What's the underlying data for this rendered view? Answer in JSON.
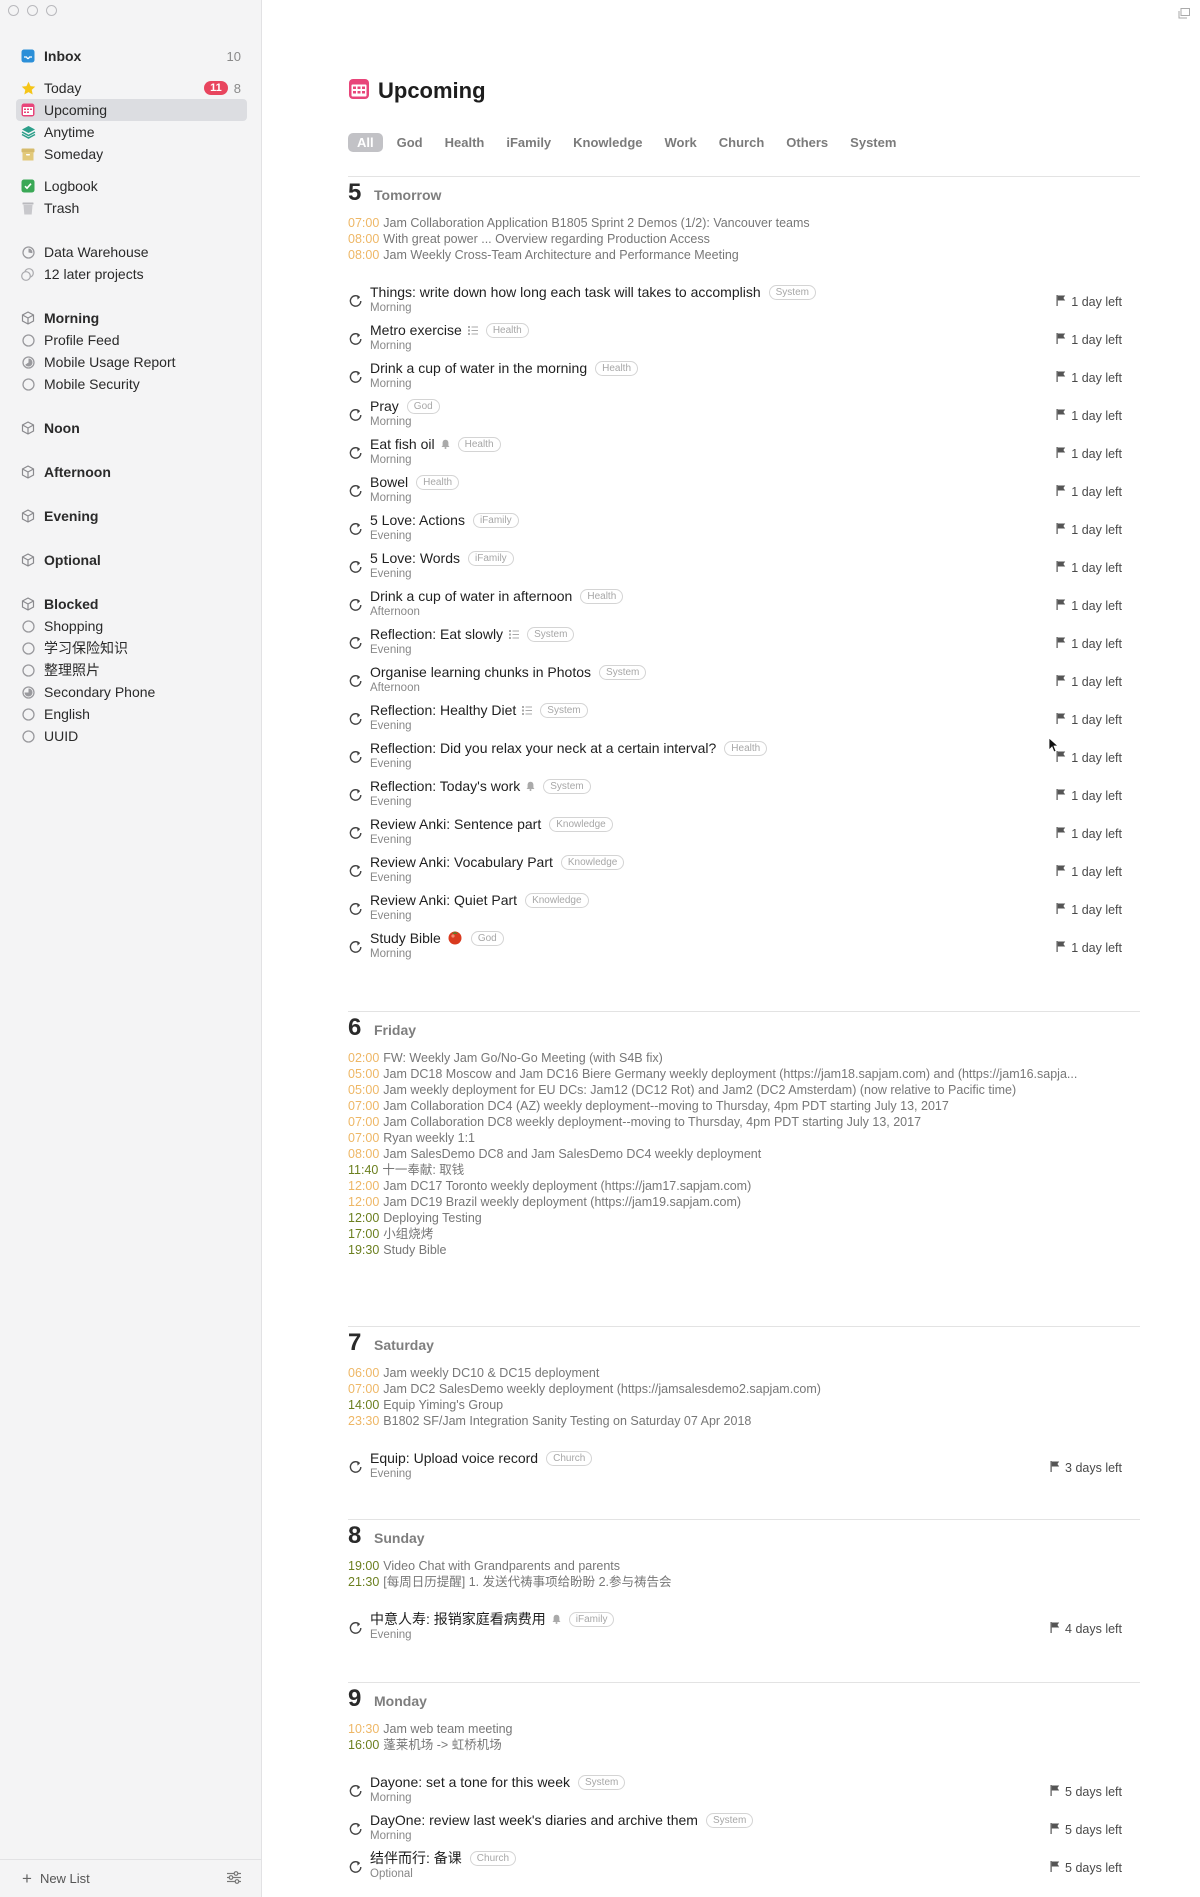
{
  "sidebar": {
    "inbox": {
      "label": "Inbox",
      "count": "10"
    },
    "today": {
      "label": "Today",
      "badge": "11",
      "count": "8"
    },
    "upcoming": {
      "label": "Upcoming"
    },
    "anytime": {
      "label": "Anytime"
    },
    "someday": {
      "label": "Someday"
    },
    "logbook": {
      "label": "Logbook"
    },
    "trash": {
      "label": "Trash"
    },
    "data_warehouse": {
      "label": "Data Warehouse"
    },
    "later_projects": {
      "label": "12 later projects"
    },
    "morning": {
      "label": "Morning",
      "items": [
        "Profile Feed",
        "Mobile Usage Report",
        "Mobile Security"
      ]
    },
    "noon": {
      "label": "Noon"
    },
    "afternoon": {
      "label": "Afternoon"
    },
    "evening": {
      "label": "Evening"
    },
    "optional": {
      "label": "Optional"
    },
    "blocked": {
      "label": "Blocked",
      "items": [
        "Shopping",
        "学习保险知识",
        "整理照片",
        "Secondary Phone",
        "English",
        "UUID"
      ]
    },
    "new_list": "New List"
  },
  "header": {
    "title": "Upcoming"
  },
  "filters": [
    "All",
    "God",
    "Health",
    "iFamily",
    "Knowledge",
    "Work",
    "Church",
    "Others",
    "System"
  ],
  "days": [
    {
      "num": "5",
      "name": "Tomorrow",
      "events": [
        {
          "time": "07:00",
          "text": "Jam Collaboration Application B1805 Sprint 2 Demos (1/2): Vancouver teams",
          "green": false
        },
        {
          "time": "08:00",
          "text": "With great power ... Overview regarding Production Access",
          "green": false
        },
        {
          "time": "08:00",
          "text": "Jam Weekly Cross-Team Architecture and Performance Meeting",
          "green": false
        }
      ],
      "tasks": [
        {
          "title": "Things: write down how long each task will takes to accomplish",
          "when": "Morning",
          "tag": "System",
          "deadline": "1 day left"
        },
        {
          "title": "Metro exercise",
          "when": "Morning",
          "tag": "Health",
          "deadline": "1 day left",
          "checklist": true
        },
        {
          "title": "Drink a cup of water in the morning",
          "when": "Morning",
          "tag": "Health",
          "deadline": "1 day left"
        },
        {
          "title": "Pray",
          "when": "Morning",
          "tag": "God",
          "deadline": "1 day left"
        },
        {
          "title": "Eat fish oil",
          "when": "Morning",
          "tag": "Health",
          "deadline": "1 day left",
          "bell": true
        },
        {
          "title": "Bowel",
          "when": "Morning",
          "tag": "Health",
          "deadline": "1 day left"
        },
        {
          "title": "5 Love: Actions",
          "when": "Evening",
          "tag": "iFamily",
          "deadline": "1 day left"
        },
        {
          "title": "5 Love: Words",
          "when": "Evening",
          "tag": "iFamily",
          "deadline": "1 day left"
        },
        {
          "title": "Drink a cup of water in afternoon",
          "when": "Afternoon",
          "tag": "Health",
          "deadline": "1 day left"
        },
        {
          "title": "Reflection: Eat slowly",
          "when": "Evening",
          "tag": "System",
          "deadline": "1 day left",
          "checklist": true
        },
        {
          "title": "Organise learning chunks in Photos",
          "when": "Afternoon",
          "tag": "System",
          "deadline": "1 day left"
        },
        {
          "title": "Reflection: Healthy Diet",
          "when": "Evening",
          "tag": "System",
          "deadline": "1 day left",
          "checklist": true
        },
        {
          "title": "Reflection: Did you relax your neck at a certain interval?",
          "when": "Evening",
          "tag": "Health",
          "deadline": "1 day left"
        },
        {
          "title": "Reflection: Today's work",
          "when": "Evening",
          "tag": "System",
          "deadline": "1 day left",
          "bell": true
        },
        {
          "title": "Review Anki: Sentence part",
          "when": "Evening",
          "tag": "Knowledge",
          "deadline": "1 day left"
        },
        {
          "title": "Review Anki: Vocabulary Part",
          "when": "Evening",
          "tag": "Knowledge",
          "deadline": "1 day left"
        },
        {
          "title": "Review Anki: Quiet Part",
          "when": "Evening",
          "tag": "Knowledge",
          "deadline": "1 day left"
        },
        {
          "title": "Study Bible",
          "when": "Morning",
          "tag": "God",
          "deadline": "1 day left",
          "tomato": true
        }
      ]
    },
    {
      "num": "6",
      "name": "Friday",
      "events": [
        {
          "time": "02:00",
          "text": "FW: Weekly Jam Go/No-Go Meeting (with S4B fix)",
          "green": false
        },
        {
          "time": "05:00",
          "text": "Jam DC18 Moscow  and Jam DC16 Biere Germany weekly deployment (https://jam18.sapjam.com) and (https://jam16.sapja...",
          "green": false
        },
        {
          "time": "05:00",
          "text": "Jam weekly deployment for EU DCs: Jam12 (DC12 Rot) and Jam2 (DC2 Amsterdam) (now relative to Pacific time)",
          "green": false
        },
        {
          "time": "07:00",
          "text": "Jam Collaboration DC4 (AZ) weekly deployment--moving to Thursday, 4pm PDT starting July 13, 2017",
          "green": false
        },
        {
          "time": "07:00",
          "text": "Jam Collaboration DC8 weekly deployment--moving to Thursday, 4pm PDT starting July 13, 2017",
          "green": false
        },
        {
          "time": "07:00",
          "text": "Ryan weekly 1:1",
          "green": false
        },
        {
          "time": "08:00",
          "text": "Jam SalesDemo DC8 and Jam SalesDemo DC4 weekly deployment",
          "green": false
        },
        {
          "time": "11:40",
          "text": "十一奉献: 取钱",
          "green": true
        },
        {
          "time": "12:00",
          "text": "Jam DC17 Toronto weekly deployment (https://jam17.sapjam.com)",
          "green": false
        },
        {
          "time": "12:00",
          "text": "Jam DC19 Brazil weekly deployment (https://jam19.sapjam.com)",
          "green": false
        },
        {
          "time": "12:00",
          "text": "Deploying Testing",
          "green": true
        },
        {
          "time": "17:00",
          "text": "小组烧烤",
          "green": true
        },
        {
          "time": "19:30",
          "text": "Study Bible",
          "green": true
        }
      ],
      "tasks": []
    },
    {
      "num": "7",
      "name": "Saturday",
      "events": [
        {
          "time": "06:00",
          "text": "Jam weekly DC10 & DC15 deployment",
          "green": false
        },
        {
          "time": "07:00",
          "text": "Jam DC2 SalesDemo weekly deployment (https://jamsalesdemo2.sapjam.com)",
          "green": false
        },
        {
          "time": "14:00",
          "text": "Equip Yiming's Group",
          "green": true
        },
        {
          "time": "23:30",
          "text": "B1802 SF/Jam Integration Sanity Testing on Saturday  07 Apr 2018",
          "green": false
        }
      ],
      "tasks": [
        {
          "title": "Equip: Upload voice record",
          "when": "Evening",
          "tag": "Church",
          "deadline": "3 days left"
        }
      ]
    },
    {
      "num": "8",
      "name": "Sunday",
      "events": [
        {
          "time": "19:00",
          "text": "Video Chat with Grandparents and parents",
          "green": true
        },
        {
          "time": "21:30",
          "text": "[每周日历提醒] 1. 发送代祷事项给盼盼 2.参与祷告会",
          "green": true
        }
      ],
      "tasks": [
        {
          "title": "中意人寿: 报销家庭看病费用",
          "when": "Evening",
          "tag": "iFamily",
          "deadline": "4 days left",
          "bell": true
        }
      ]
    },
    {
      "num": "9",
      "name": "Monday",
      "events": [
        {
          "time": "10:30",
          "text": "Jam web team meeting",
          "green": false
        },
        {
          "time": "16:00",
          "text": "蓬莱机场 -> 虹桥机场",
          "green": true
        }
      ],
      "tasks": [
        {
          "title": "Dayone: set a tone for this week",
          "when": "Morning",
          "tag": "System",
          "deadline": "5 days left"
        },
        {
          "title": "DayOne: review last week's diaries and archive them",
          "when": "Morning",
          "tag": "System",
          "deadline": "5 days left"
        },
        {
          "title": "结伴而行: 备课",
          "when": "Optional",
          "tag": "Church",
          "deadline": "5 days left"
        }
      ]
    }
  ]
}
